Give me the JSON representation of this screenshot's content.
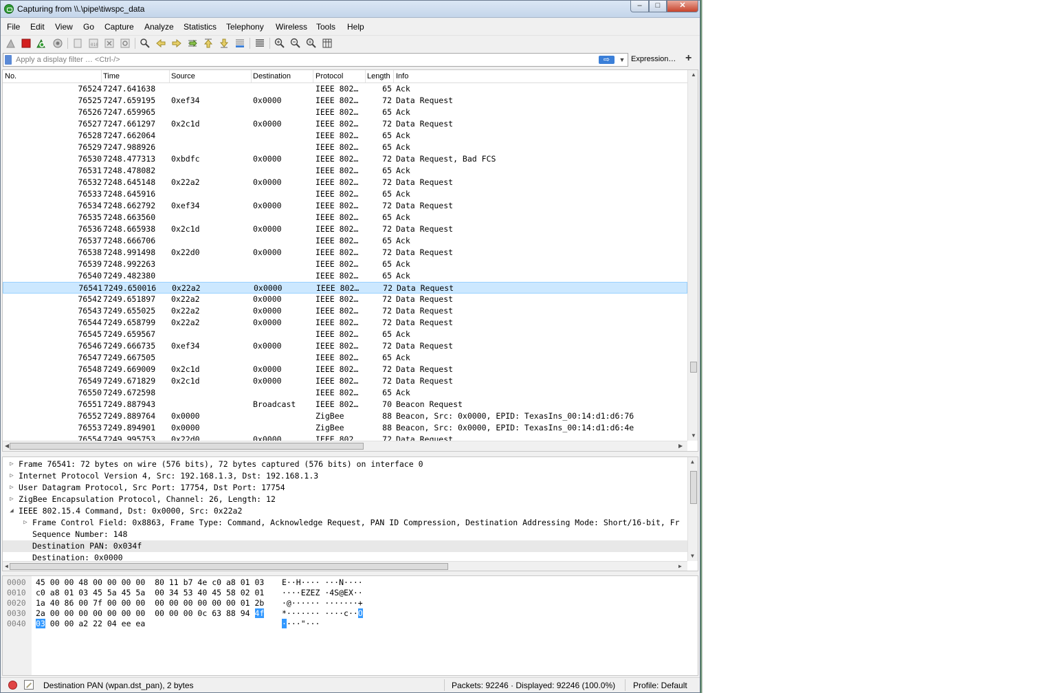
{
  "window": {
    "title": "Capturing from \\\\.\\pipe\\tiwspc_data",
    "minimize": "–",
    "maximize": "□",
    "close": "✕"
  },
  "menu": [
    "File",
    "Edit",
    "View",
    "Go",
    "Capture",
    "Analyze",
    "Statistics",
    "Telephony",
    "Wireless",
    "Tools",
    "Help"
  ],
  "toolbar": {
    "icons": [
      "shark-fin-start-icon",
      "stop-capture-icon",
      "restart-capture-icon",
      "capture-options-icon",
      "open-file-icon",
      "save-file-icon",
      "close-file-icon",
      "reload-file-icon",
      "find-packet-icon",
      "go-back-icon",
      "go-forward-icon",
      "go-to-packet-icon",
      "go-first-icon",
      "go-last-icon",
      "autoscroll-icon",
      "colorize-icon",
      "zoom-in-icon",
      "zoom-out-icon",
      "zoom-normal-icon",
      "resize-columns-icon"
    ]
  },
  "filter": {
    "placeholder": "Apply a display filter … <Ctrl-/>",
    "value": "",
    "apply_label": "⇨",
    "expression_label": "Expression…",
    "add_label": "+"
  },
  "packet_list": {
    "columns": [
      "No.",
      "Time",
      "Source",
      "Destination",
      "Protocol",
      "Length",
      "Info"
    ],
    "selected_no": "76541",
    "rows": [
      {
        "no": "76524",
        "time": "7247.641638",
        "src": "",
        "dst": "",
        "proto": "IEEE 802…",
        "len": "65",
        "info": "Ack"
      },
      {
        "no": "76525",
        "time": "7247.659195",
        "src": "0xef34",
        "dst": "0x0000",
        "proto": "IEEE 802…",
        "len": "72",
        "info": "Data Request"
      },
      {
        "no": "76526",
        "time": "7247.659965",
        "src": "",
        "dst": "",
        "proto": "IEEE 802…",
        "len": "65",
        "info": "Ack"
      },
      {
        "no": "76527",
        "time": "7247.661297",
        "src": "0x2c1d",
        "dst": "0x0000",
        "proto": "IEEE 802…",
        "len": "72",
        "info": "Data Request"
      },
      {
        "no": "76528",
        "time": "7247.662064",
        "src": "",
        "dst": "",
        "proto": "IEEE 802…",
        "len": "65",
        "info": "Ack"
      },
      {
        "no": "76529",
        "time": "7247.988926",
        "src": "",
        "dst": "",
        "proto": "IEEE 802…",
        "len": "65",
        "info": "Ack"
      },
      {
        "no": "76530",
        "time": "7248.477313",
        "src": "0xbdfc",
        "dst": "0x0000",
        "proto": "IEEE 802…",
        "len": "72",
        "info": "Data Request, Bad FCS"
      },
      {
        "no": "76531",
        "time": "7248.478082",
        "src": "",
        "dst": "",
        "proto": "IEEE 802…",
        "len": "65",
        "info": "Ack"
      },
      {
        "no": "76532",
        "time": "7248.645148",
        "src": "0x22a2",
        "dst": "0x0000",
        "proto": "IEEE 802…",
        "len": "72",
        "info": "Data Request"
      },
      {
        "no": "76533",
        "time": "7248.645916",
        "src": "",
        "dst": "",
        "proto": "IEEE 802…",
        "len": "65",
        "info": "Ack"
      },
      {
        "no": "76534",
        "time": "7248.662792",
        "src": "0xef34",
        "dst": "0x0000",
        "proto": "IEEE 802…",
        "len": "72",
        "info": "Data Request"
      },
      {
        "no": "76535",
        "time": "7248.663560",
        "src": "",
        "dst": "",
        "proto": "IEEE 802…",
        "len": "65",
        "info": "Ack"
      },
      {
        "no": "76536",
        "time": "7248.665938",
        "src": "0x2c1d",
        "dst": "0x0000",
        "proto": "IEEE 802…",
        "len": "72",
        "info": "Data Request"
      },
      {
        "no": "76537",
        "time": "7248.666706",
        "src": "",
        "dst": "",
        "proto": "IEEE 802…",
        "len": "65",
        "info": "Ack"
      },
      {
        "no": "76538",
        "time": "7248.991498",
        "src": "0x22d0",
        "dst": "0x0000",
        "proto": "IEEE 802…",
        "len": "72",
        "info": "Data Request"
      },
      {
        "no": "76539",
        "time": "7248.992263",
        "src": "",
        "dst": "",
        "proto": "IEEE 802…",
        "len": "65",
        "info": "Ack"
      },
      {
        "no": "76540",
        "time": "7249.482380",
        "src": "",
        "dst": "",
        "proto": "IEEE 802…",
        "len": "65",
        "info": "Ack"
      },
      {
        "no": "76541",
        "time": "7249.650016",
        "src": "0x22a2",
        "dst": "0x0000",
        "proto": "IEEE 802…",
        "len": "72",
        "info": "Data Request"
      },
      {
        "no": "76542",
        "time": "7249.651897",
        "src": "0x22a2",
        "dst": "0x0000",
        "proto": "IEEE 802…",
        "len": "72",
        "info": "Data Request"
      },
      {
        "no": "76543",
        "time": "7249.655025",
        "src": "0x22a2",
        "dst": "0x0000",
        "proto": "IEEE 802…",
        "len": "72",
        "info": "Data Request"
      },
      {
        "no": "76544",
        "time": "7249.658799",
        "src": "0x22a2",
        "dst": "0x0000",
        "proto": "IEEE 802…",
        "len": "72",
        "info": "Data Request"
      },
      {
        "no": "76545",
        "time": "7249.659567",
        "src": "",
        "dst": "",
        "proto": "IEEE 802…",
        "len": "65",
        "info": "Ack"
      },
      {
        "no": "76546",
        "time": "7249.666735",
        "src": "0xef34",
        "dst": "0x0000",
        "proto": "IEEE 802…",
        "len": "72",
        "info": "Data Request"
      },
      {
        "no": "76547",
        "time": "7249.667505",
        "src": "",
        "dst": "",
        "proto": "IEEE 802…",
        "len": "65",
        "info": "Ack"
      },
      {
        "no": "76548",
        "time": "7249.669009",
        "src": "0x2c1d",
        "dst": "0x0000",
        "proto": "IEEE 802…",
        "len": "72",
        "info": "Data Request"
      },
      {
        "no": "76549",
        "time": "7249.671829",
        "src": "0x2c1d",
        "dst": "0x0000",
        "proto": "IEEE 802…",
        "len": "72",
        "info": "Data Request"
      },
      {
        "no": "76550",
        "time": "7249.672598",
        "src": "",
        "dst": "",
        "proto": "IEEE 802…",
        "len": "65",
        "info": "Ack"
      },
      {
        "no": "76551",
        "time": "7249.887943",
        "src": "",
        "dst": "Broadcast",
        "proto": "IEEE 802…",
        "len": "70",
        "info": "Beacon Request"
      },
      {
        "no": "76552",
        "time": "7249.889764",
        "src": "0x0000",
        "dst": "",
        "proto": "ZigBee",
        "len": "88",
        "info": "Beacon, Src: 0x0000, EPID: TexasIns_00:14:d1:d6:76"
      },
      {
        "no": "76553",
        "time": "7249.894901",
        "src": "0x0000",
        "dst": "",
        "proto": "ZigBee",
        "len": "88",
        "info": "Beacon, Src: 0x0000, EPID: TexasIns_00:14:d1:d6:4e"
      },
      {
        "no": "76554",
        "time": "7249.995753",
        "src": "0x22d0",
        "dst": "0x0000",
        "proto": "IEEE 802…",
        "len": "72",
        "info": "Data Request"
      }
    ]
  },
  "details": {
    "rows": [
      {
        "expander": "collapsed",
        "indent": 0,
        "text": "Frame 76541: 72 bytes on wire (576 bits), 72 bytes captured (576 bits) on interface 0"
      },
      {
        "expander": "collapsed",
        "indent": 0,
        "text": "Internet Protocol Version 4, Src: 192.168.1.3, Dst: 192.168.1.3"
      },
      {
        "expander": "collapsed",
        "indent": 0,
        "text": "User Datagram Protocol, Src Port: 17754, Dst Port: 17754"
      },
      {
        "expander": "collapsed",
        "indent": 0,
        "text": "ZigBee Encapsulation Protocol, Channel: 26, Length: 12"
      },
      {
        "expander": "expanded",
        "indent": 0,
        "text": "IEEE 802.15.4 Command, Dst: 0x0000, Src: 0x22a2"
      },
      {
        "expander": "collapsed",
        "indent": 1,
        "text": "Frame Control Field: 0x8863, Frame Type: Command, Acknowledge Request, PAN ID Compression, Destination Addressing Mode: Short/16-bit, Fr"
      },
      {
        "expander": "none",
        "indent": 1,
        "text": "Sequence Number: 148"
      },
      {
        "expander": "none",
        "indent": 1,
        "text": "Destination PAN: 0x034f",
        "highlight": true
      },
      {
        "expander": "none",
        "indent": 1,
        "text": "Destination: 0x0000"
      }
    ]
  },
  "bytes": {
    "rows": [
      {
        "offset": "0000",
        "hex_a": "45 00 00 48 00 00 00 00",
        "hex_b": "80 11 b7 4e c0 a8 01 03",
        "sel_hex": "",
        "ascii_a": "E··H····",
        "ascii_b": "···N····",
        "sel_ascii": ""
      },
      {
        "offset": "0010",
        "hex_a": "c0 a8 01 03 45 5a 45 5a",
        "hex_b": "00 34 53 40 45 58 02 01",
        "sel_hex": "",
        "ascii_a": "····EZEZ",
        "ascii_b": "·4S@EX··",
        "sel_ascii": ""
      },
      {
        "offset": "0020",
        "hex_a": "1a 40 86 00 7f 00 00 00",
        "hex_b": "00 00 00 00 00 00 01 2b",
        "sel_hex": "",
        "ascii_a": "·@······",
        "ascii_b": "·······+",
        "sel_ascii": ""
      },
      {
        "offset": "0030",
        "hex_a": "2a 00 00 00 00 00 00 00",
        "hex_b": "00 00 00 0c 63 88 94",
        "sel_hex": "4f",
        "ascii_a": "*·······",
        "ascii_b": "····c··",
        "sel_ascii": "O"
      },
      {
        "offset": "0040",
        "hex_a": "",
        "hex_b": "00 00 a2 22 04 ee ea",
        "sel_hex_lead": "03",
        "ascii_a": "",
        "ascii_b": "···\"···",
        "sel_ascii_lead": "·"
      }
    ]
  },
  "status": {
    "field": "Destination PAN (wpan.dst_pan), 2 bytes",
    "packets": "Packets: 92246 · Displayed: 92246 (100.0%)",
    "profile": "Profile: Default"
  },
  "colors": {
    "selected_row_bg": "#cce8ff",
    "byte_highlight": "#3399ff",
    "detail_highlight": "#e8e8e8"
  }
}
